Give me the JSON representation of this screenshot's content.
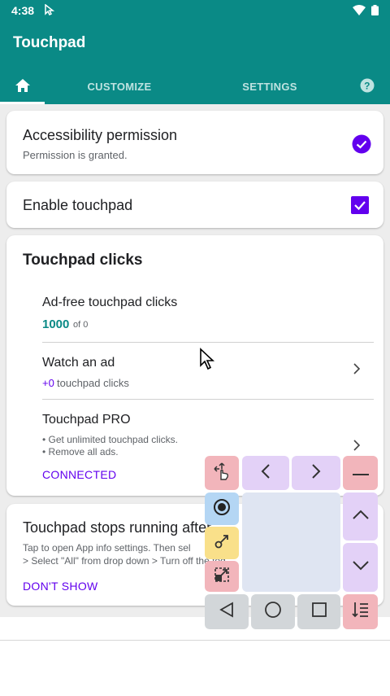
{
  "status_bar": {
    "time": "4:38"
  },
  "app": {
    "title": "Touchpad"
  },
  "tabs": [
    {
      "label": "CUSTOMIZE"
    },
    {
      "label": "SETTINGS"
    }
  ],
  "cards": {
    "accessibility": {
      "title": "Accessibility permission",
      "subtitle": "Permission is granted."
    },
    "enable": {
      "title": "Enable touchpad"
    },
    "clicks": {
      "heading": "Touchpad clicks",
      "adfree_title": "Ad-free touchpad clicks",
      "adfree_count": "1000",
      "adfree_of": "of 0",
      "watch_title": "Watch an ad",
      "watch_plus": "+0",
      "watch_suffix": "touchpad clicks",
      "pro_title": "Touchpad PRO",
      "pro_line1": "• Get unlimited touchpad clicks.",
      "pro_line2": "• Remove all ads.",
      "connected": "CONNECTED"
    },
    "stops": {
      "title": "Touchpad stops running after",
      "line1": "Tap to open App info settings. Then sel",
      "line2": "> Select \"All\" from drop down > Turn off the tog",
      "action": "DON'T SHOW"
    }
  },
  "colors": {
    "appbar": "#0a8a86",
    "accent_purple": "#6200ee",
    "count_teal": "#0a8a86"
  }
}
